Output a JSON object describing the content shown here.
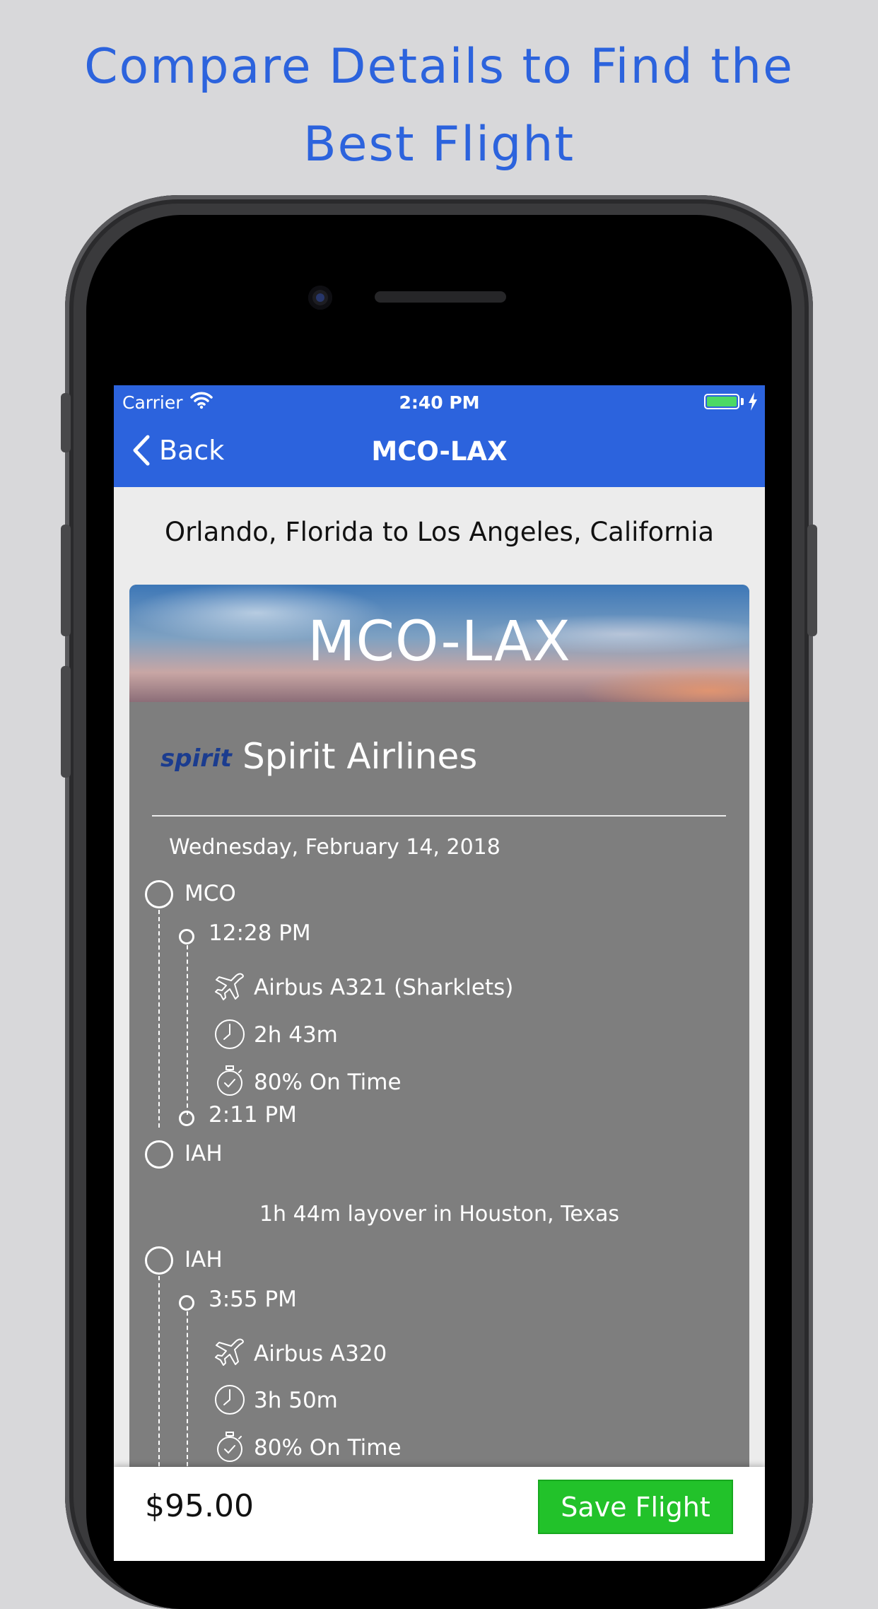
{
  "headline": {
    "line1": "Compare Details to Find the",
    "line2": "Best Flight"
  },
  "status_bar": {
    "carrier": "Carrier",
    "time": "2:40 PM"
  },
  "nav": {
    "back_label": "Back",
    "title": "MCO-LAX"
  },
  "route_description": "Orlando, Florida to Los Angeles, California",
  "card": {
    "hero_title": "MCO-LAX",
    "airline_logo_text": "spirit",
    "airline_name": "Spirit Airlines",
    "date": "Wednesday, February 14, 2018",
    "segments": [
      {
        "origin": "MCO",
        "depart_time": "12:28 PM",
        "aircraft": "Airbus A321 (Sharklets)",
        "duration": "2h 43m",
        "on_time": "80% On Time",
        "arrive_time": "2:11 PM",
        "destination": "IAH"
      },
      {
        "origin": "IAH",
        "depart_time": "3:55 PM",
        "aircraft": "Airbus A320",
        "duration": "3h 50m",
        "on_time": "80% On Time"
      }
    ],
    "layover": "1h 44m layover in Houston, Texas"
  },
  "footer": {
    "price": "$95.00",
    "save_label": "Save Flight"
  },
  "colors": {
    "brand_blue": "#2c63dd",
    "card_gray": "#7e7e7e",
    "save_green": "#22c22a",
    "battery_green": "#4cd964"
  },
  "icons": [
    "wifi-icon",
    "battery-icon",
    "charging-bolt-icon",
    "chevron-left-icon",
    "plane-icon",
    "clock-icon",
    "stopwatch-icon"
  ]
}
